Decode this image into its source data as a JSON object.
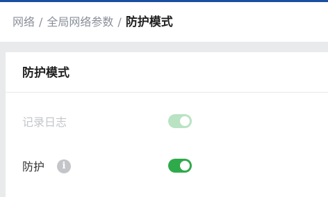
{
  "breadcrumb": {
    "items": [
      "网络",
      "全局网络参数"
    ],
    "current": "防护模式",
    "separator": "/"
  },
  "card": {
    "title": "防护模式"
  },
  "settings": [
    {
      "label": "记录日志",
      "enabled": true,
      "disabled": true
    },
    {
      "label": "防护",
      "enabled": true,
      "disabled": false,
      "info_icon": "i"
    }
  ],
  "colors": {
    "accent": "#1a4fa0",
    "toggle_on": "#2faa4a",
    "toggle_disabled": "#b9e3c2"
  }
}
